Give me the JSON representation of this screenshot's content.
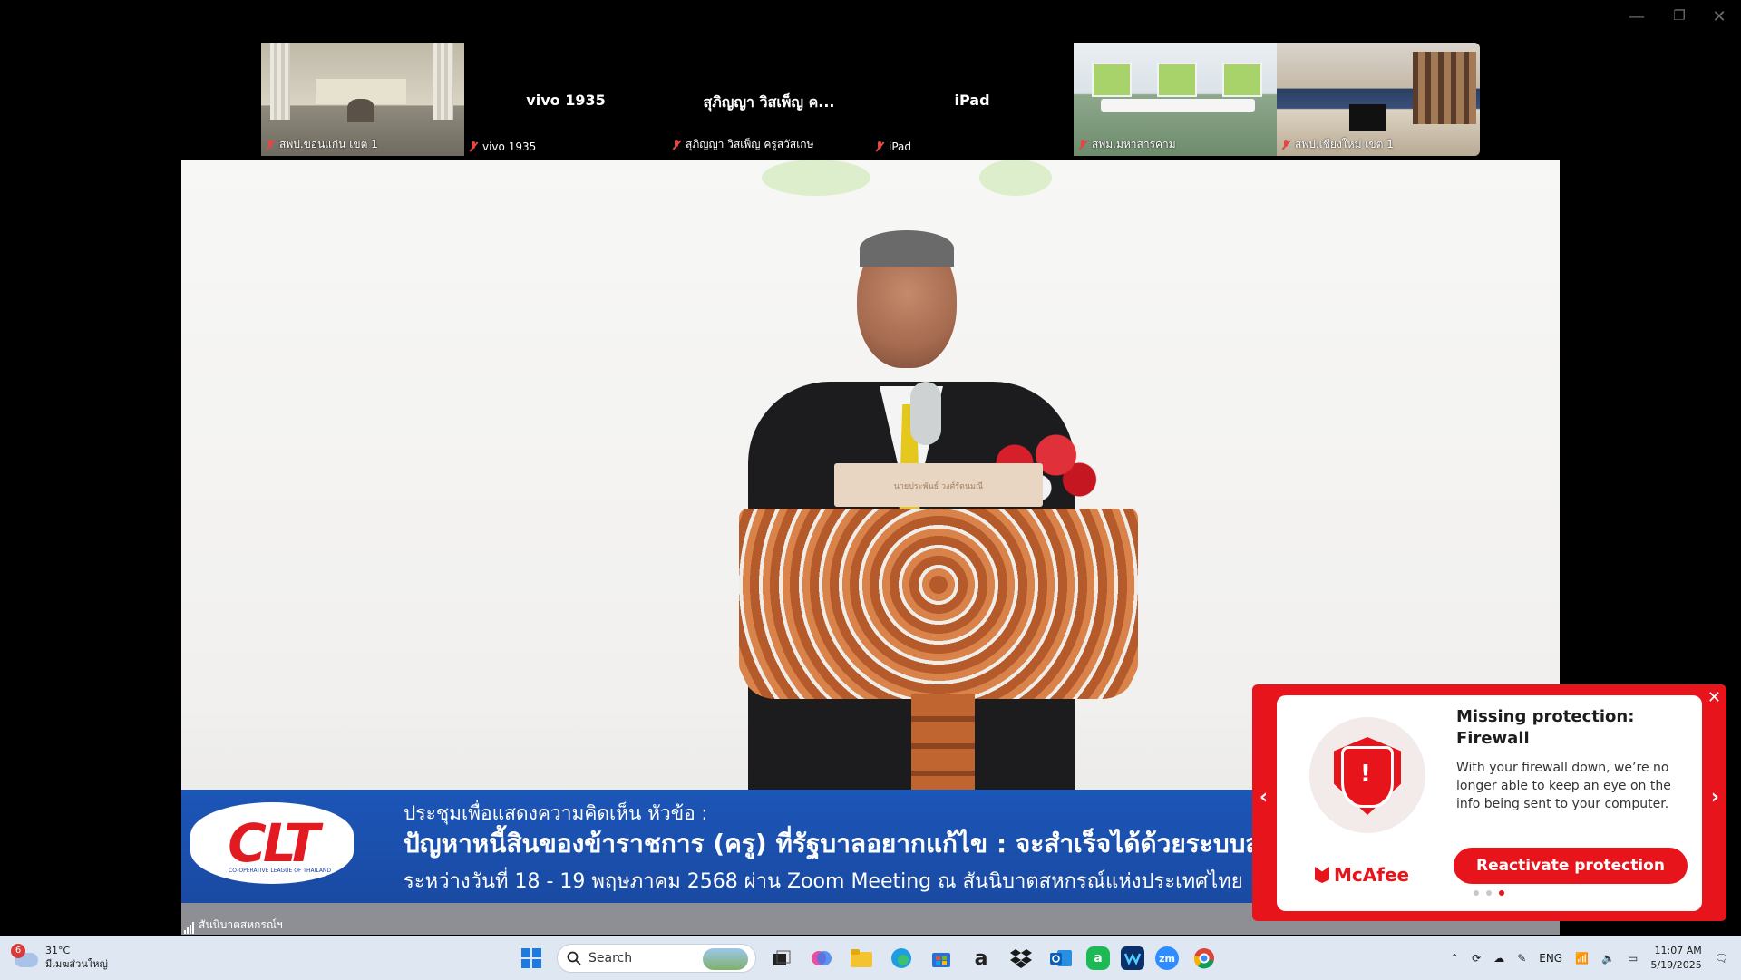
{
  "window": {
    "minimize": "—",
    "restore": "❐",
    "close": "✕"
  },
  "gallery": [
    {
      "label": "สพป.ขอนแก่น เขต 1",
      "video": true
    },
    {
      "label": "vivo 1935",
      "big_name": "vivo 1935",
      "video": false
    },
    {
      "label": "สุภิญญา วิสเพ็ญ ครูสวัสเกษ",
      "big_name": "สุภิญญา วิสเพ็ญ ค...",
      "video": false
    },
    {
      "label": "iPad",
      "big_name": "iPad",
      "video": false
    },
    {
      "label": "สพม.มหาสารคาม",
      "video": true
    },
    {
      "label": "สพป.เชียงใหม่ เขต 1",
      "video": true
    }
  ],
  "stage": {
    "podium_name": "นายประพันธ์ วงศ์รัตนมณี",
    "logo": "CLT",
    "logo_sub": "CO-OPERATIVE LEAGUE OF THAILAND",
    "banner_line1": "ประชุมเพื่อแสดงความคิดเห็น หัวข้อ :",
    "banner_line2": "ปัญหาหนี้สินของข้าราชการ (ครู) ที่รัฐบาลอยากแก้ไข : จะสำเร็จได้ด้วยระบบส",
    "banner_line3": "ระหว่างวันที่  18 - 19 พฤษภาคม 2568 ผ่าน Zoom Meeting ณ สันนิบาตสหกรณ์แห่งประเทศไทย",
    "signal_label": "สันนิบาตสหกรณ์ฯ"
  },
  "mcafee": {
    "title": "Missing protection: Firewall",
    "body": "With your firewall down, we’re no longer able to keep an eye on the info being sent to your computer.",
    "brand": "McAfee",
    "button": "Reactivate protection",
    "close": "✕",
    "prev": "‹",
    "next": "›",
    "page_count": 3,
    "active_page": 3,
    "accent": "#e8141c"
  },
  "taskbar": {
    "weather_badge": "6",
    "temperature": "31°C",
    "weather_desc": "มีเมฆส่วนใหญ่",
    "search_placeholder": "Search",
    "apps": [
      "windows-start",
      "task-view",
      "copilot",
      "file-explorer",
      "edge",
      "microsoft-store",
      "amazon",
      "dropbox",
      "outlook",
      "line-app",
      "webex",
      "zoom",
      "chrome"
    ],
    "language": "ENG",
    "time": "11:07 AM",
    "date": "5/19/2025"
  }
}
